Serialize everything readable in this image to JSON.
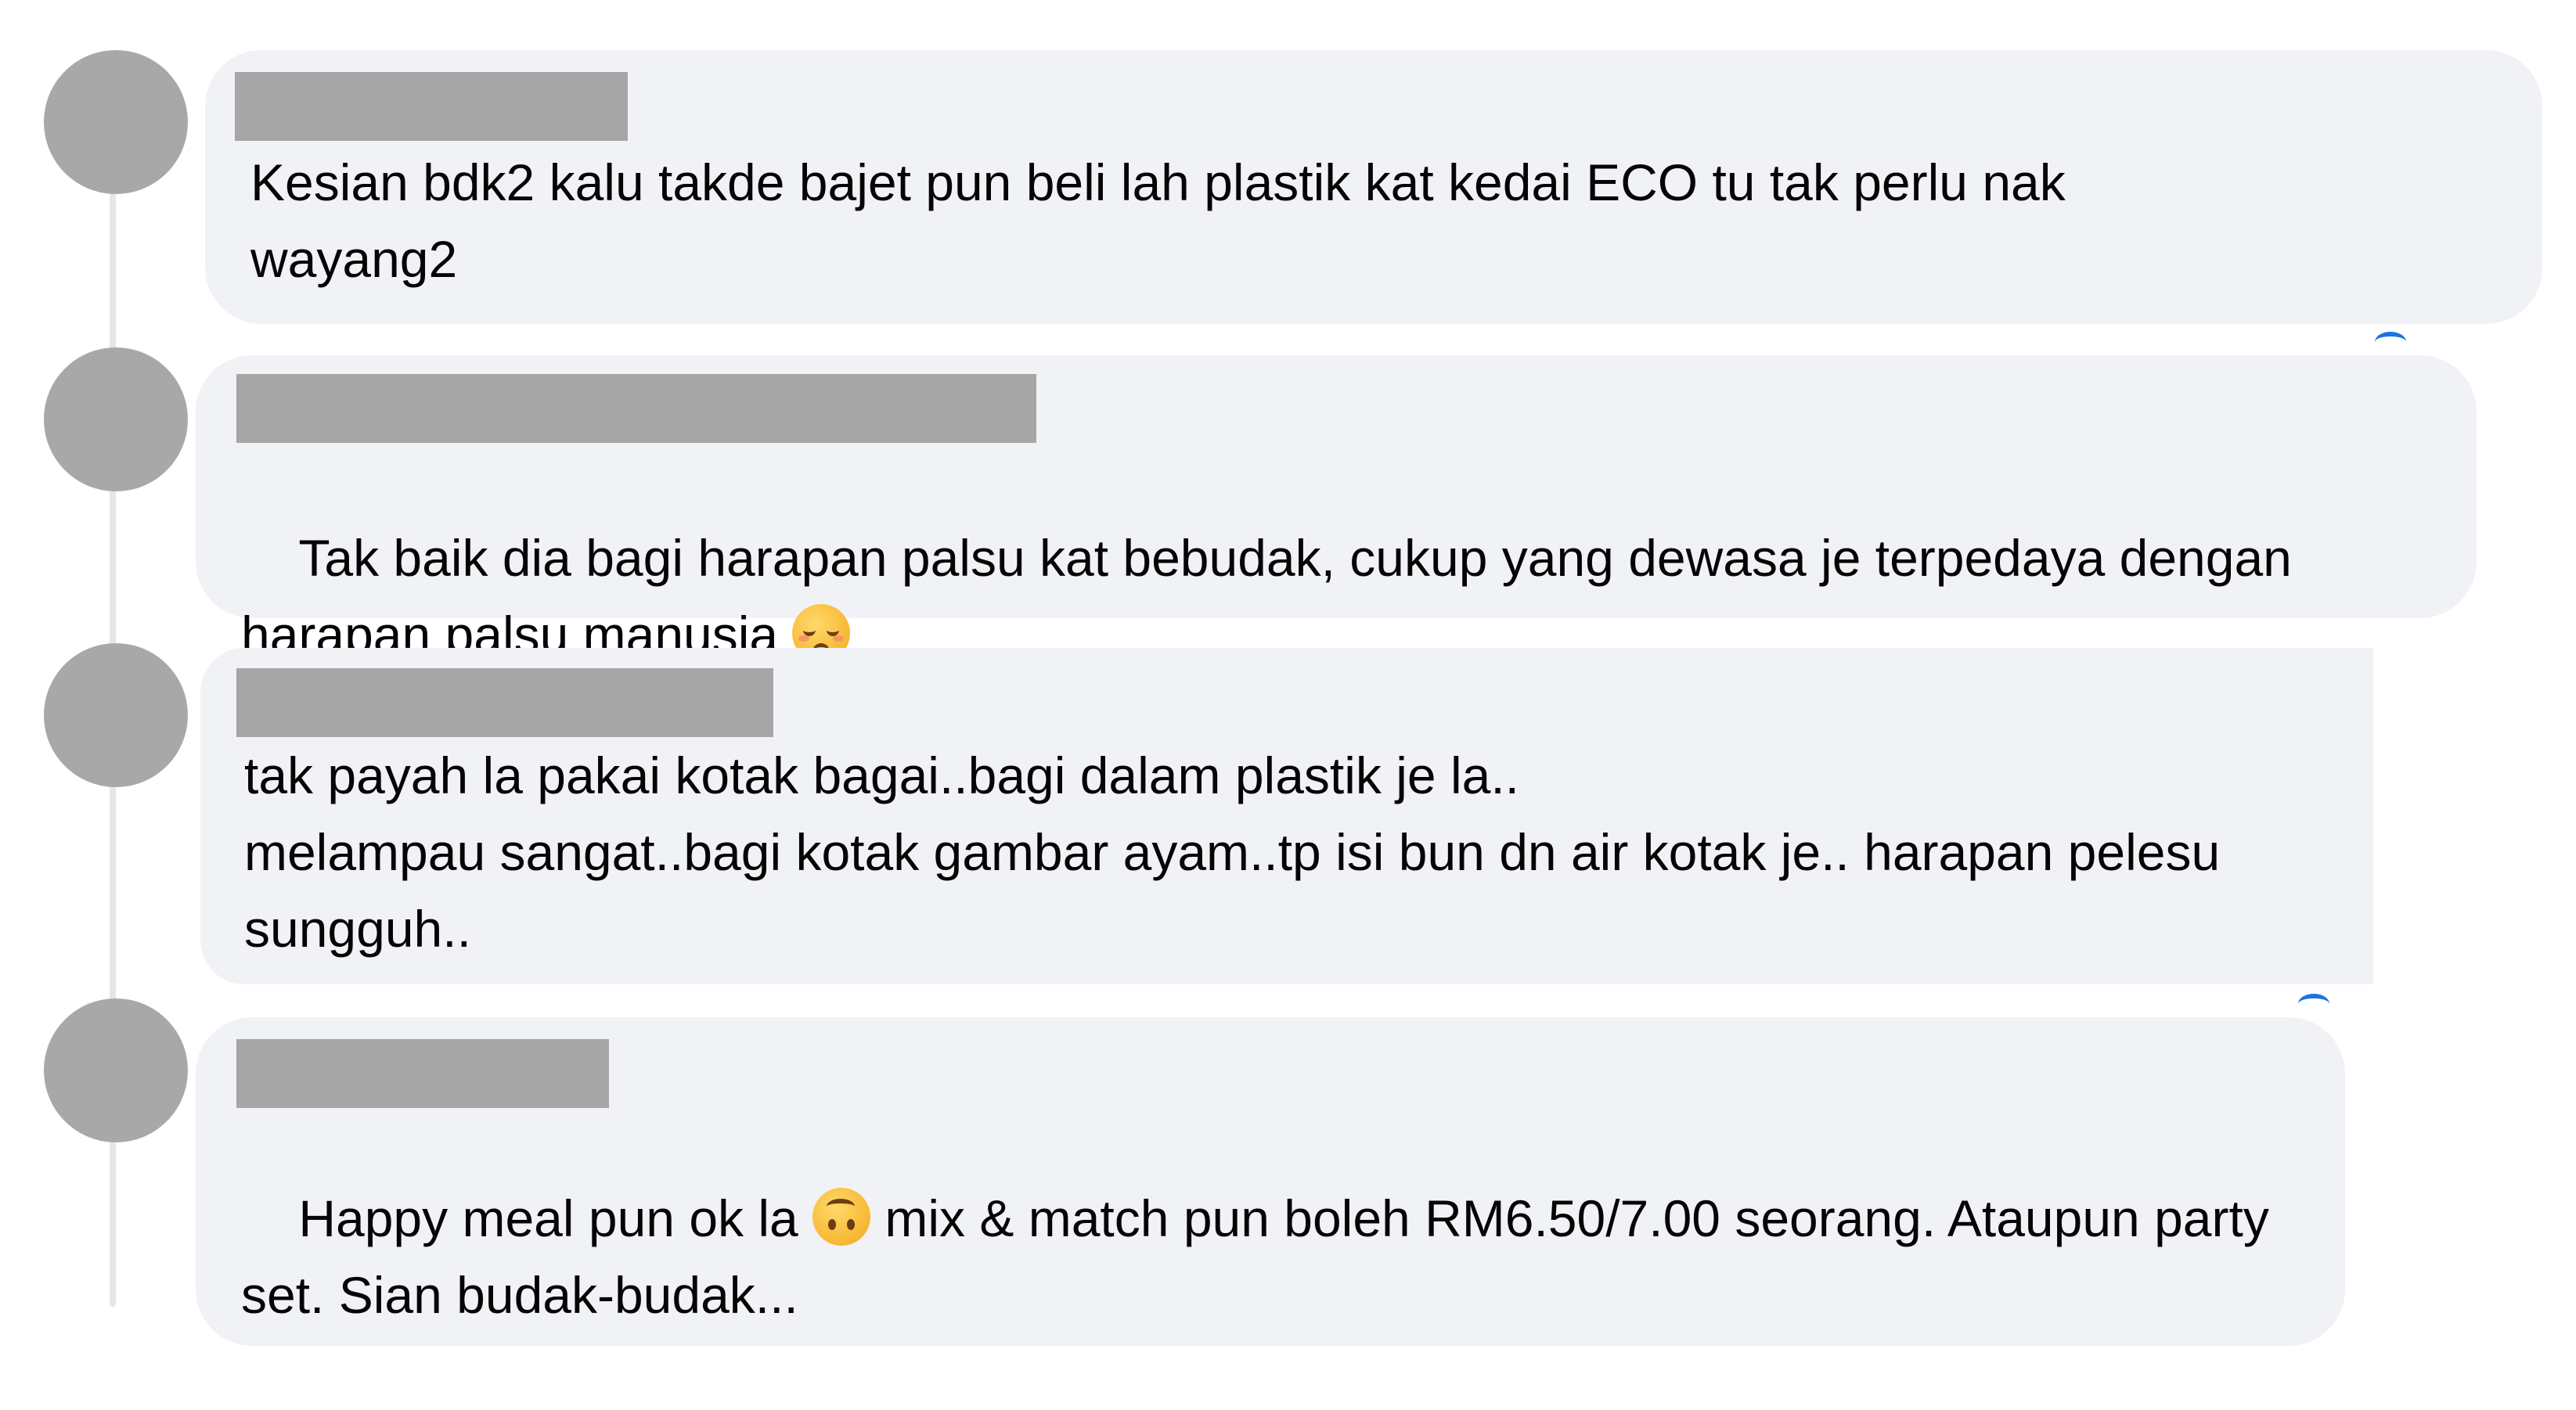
{
  "comments": [
    {
      "text": "Kesian bdk2 kalu takde bajet pun beli lah plastik kat kedai ECO tu tak perlu nak\nwayang2"
    },
    {
      "text_before_emoji": "Tak baik dia bagi harapan palsu kat bebudak, cukup yang dewasa je terpedaya dengan\nharapan palsu manusia ",
      "emoji": "relieved-face"
    },
    {
      "text": "tak payah la pakai kotak bagai..bagi dalam plastik je la..\nmelampau sangat..bagi kotak gambar ayam..tp isi bun dn air kotak je.. harapan pelesu\nsungguh.."
    },
    {
      "text_before_emoji": "Happy meal pun ok la ",
      "emoji": "upside-down-face",
      "text_after_emoji": " mix & match pun boleh RM6.50/7.00 seorang. Ataupun party\nset. Sian budak-budak..."
    }
  ],
  "colors": {
    "bubble": "#f0f2f5",
    "avatar": "#a8a8a8",
    "redaction": "#a6a6a6",
    "thread_line": "#e4e6eb",
    "text": "#050505",
    "accent": "#1b74e4"
  }
}
